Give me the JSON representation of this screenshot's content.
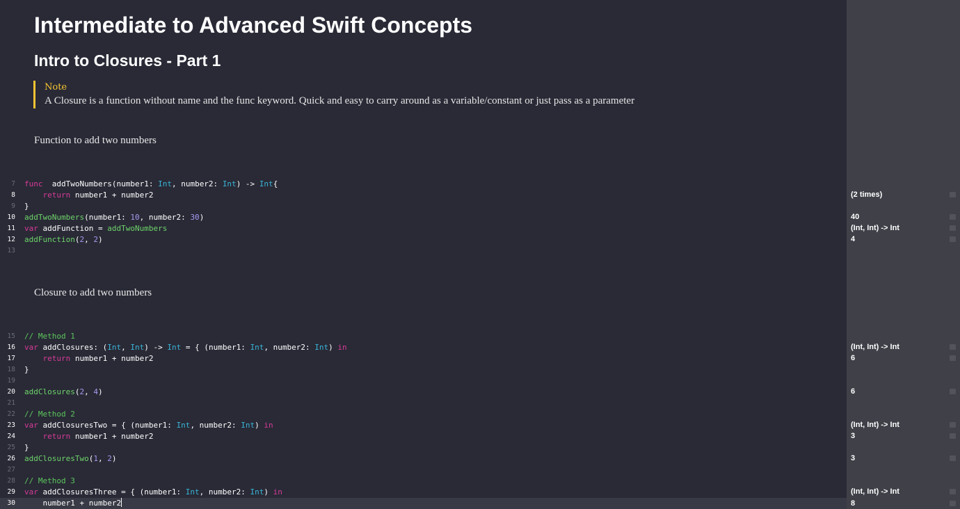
{
  "doc": {
    "title": "Intermediate to Advanced Swift Concepts",
    "subtitle": "Intro to Closures - Part 1",
    "note_label": "Note",
    "note_text": "A Closure is a function without name and the func keyword. Quick and easy to carry around as a variable/constant or just pass as a parameter",
    "para1": "Function to add two numbers",
    "para2": "Closure to add two numbers"
  },
  "colors": {
    "background": "#292a36",
    "results_sidebar": "#3f4048",
    "keyword": "#d83a98",
    "type": "#3ab4d8",
    "function": "#6ed36a",
    "number": "#a599f0",
    "comment": "#5cc65c",
    "note_accent": "#f6c331"
  },
  "block1": [
    {
      "num": "7",
      "code": [
        [
          "kw",
          "func"
        ],
        [
          "",
          "  addTwoNumbers(number1: "
        ],
        [
          "typ",
          "Int"
        ],
        [
          "",
          ", number2: "
        ],
        [
          "typ",
          "Int"
        ],
        [
          "",
          ") -> "
        ],
        [
          "typ",
          "Int"
        ],
        [
          "",
          "{"
        ]
      ]
    },
    {
      "num": "8",
      "code": [
        [
          "",
          "    "
        ],
        [
          "kw",
          "return"
        ],
        [
          "",
          " number1 + number2"
        ]
      ],
      "result": "(2 times)"
    },
    {
      "num": "9",
      "code": [
        [
          "",
          "}"
        ]
      ]
    },
    {
      "num": "10",
      "code": [
        [
          "fn",
          "addTwoNumbers"
        ],
        [
          "",
          "(number1: "
        ],
        [
          "num",
          "10"
        ],
        [
          "",
          ", number2: "
        ],
        [
          "num",
          "30"
        ],
        [
          "",
          ")"
        ]
      ],
      "result": "40"
    },
    {
      "num": "11",
      "code": [
        [
          "kw",
          "var"
        ],
        [
          "",
          " addFunction = "
        ],
        [
          "fn",
          "addTwoNumbers"
        ]
      ],
      "result": "(Int, Int) -> Int"
    },
    {
      "num": "12",
      "code": [
        [
          "fn",
          "addFunction"
        ],
        [
          "",
          "("
        ],
        [
          "num",
          "2"
        ],
        [
          "",
          ", "
        ],
        [
          "num",
          "2"
        ],
        [
          "",
          ")"
        ]
      ],
      "result": "4"
    },
    {
      "num": "13",
      "code": []
    }
  ],
  "block2": [
    {
      "num": "15",
      "code": [
        [
          "cmt",
          "// Method 1"
        ]
      ]
    },
    {
      "num": "16",
      "code": [
        [
          "kw",
          "var"
        ],
        [
          "",
          " addClosures: ("
        ],
        [
          "typ",
          "Int"
        ],
        [
          "",
          ", "
        ],
        [
          "typ",
          "Int"
        ],
        [
          "",
          ") -> "
        ],
        [
          "typ",
          "Int"
        ],
        [
          "",
          " = { (number1: "
        ],
        [
          "typ",
          "Int"
        ],
        [
          "",
          ", number2: "
        ],
        [
          "typ",
          "Int"
        ],
        [
          "",
          ") "
        ],
        [
          "kw",
          "in"
        ]
      ],
      "result": "(Int, Int) -> Int"
    },
    {
      "num": "17",
      "code": [
        [
          "",
          "    "
        ],
        [
          "kw",
          "return"
        ],
        [
          "",
          " number1 + number2"
        ]
      ],
      "result": "6"
    },
    {
      "num": "18",
      "code": [
        [
          "",
          "}"
        ]
      ]
    },
    {
      "num": "19",
      "code": []
    },
    {
      "num": "20",
      "code": [
        [
          "fn",
          "addClosures"
        ],
        [
          "",
          "("
        ],
        [
          "num",
          "2"
        ],
        [
          "",
          ", "
        ],
        [
          "num",
          "4"
        ],
        [
          "",
          ")"
        ]
      ],
      "result": "6"
    },
    {
      "num": "21",
      "code": []
    },
    {
      "num": "22",
      "code": [
        [
          "cmt",
          "// Method 2"
        ]
      ]
    },
    {
      "num": "23",
      "code": [
        [
          "kw",
          "var"
        ],
        [
          "",
          " addClosuresTwo = { (number1: "
        ],
        [
          "typ",
          "Int"
        ],
        [
          "",
          ", number2: "
        ],
        [
          "typ",
          "Int"
        ],
        [
          "",
          ") "
        ],
        [
          "kw",
          "in"
        ]
      ],
      "result": "(Int, Int) -> Int"
    },
    {
      "num": "24",
      "code": [
        [
          "",
          "    "
        ],
        [
          "kw",
          "return"
        ],
        [
          "",
          " number1 + number2"
        ]
      ],
      "result": "3"
    },
    {
      "num": "25",
      "code": [
        [
          "",
          "}"
        ]
      ]
    },
    {
      "num": "26",
      "code": [
        [
          "fn",
          "addClosuresTwo"
        ],
        [
          "",
          "("
        ],
        [
          "num",
          "1"
        ],
        [
          "",
          ", "
        ],
        [
          "num",
          "2"
        ],
        [
          "",
          ")"
        ]
      ],
      "result": "3"
    },
    {
      "num": "27",
      "code": []
    },
    {
      "num": "28",
      "code": [
        [
          "cmt",
          "// Method 3"
        ]
      ]
    },
    {
      "num": "29",
      "code": [
        [
          "kw",
          "var"
        ],
        [
          "",
          " addClosuresThree = { (number1: "
        ],
        [
          "typ",
          "Int"
        ],
        [
          "",
          ", number2: "
        ],
        [
          "typ",
          "Int"
        ],
        [
          "",
          ") "
        ],
        [
          "kw",
          "in"
        ]
      ],
      "result": "(Int, Int) -> Int"
    },
    {
      "num": "30",
      "code": [
        [
          "",
          "    number1 + number2"
        ]
      ],
      "result": "8",
      "current": true
    }
  ]
}
